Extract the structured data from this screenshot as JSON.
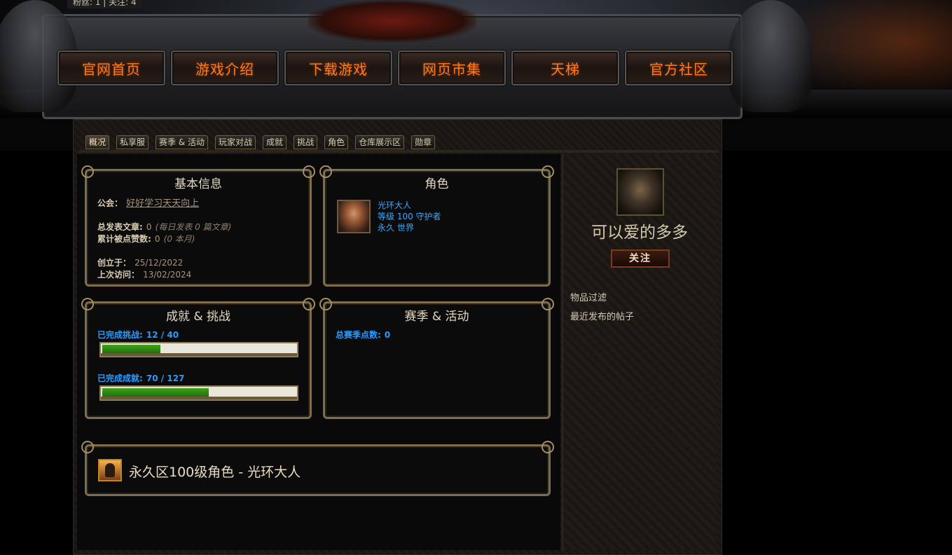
{
  "header": {
    "follow_stats": "粉丝: 1 | 关注: 4"
  },
  "nav": [
    "官网首页",
    "游戏介绍",
    "下载游戏",
    "网页市集",
    "天梯",
    "官方社区"
  ],
  "tabs": [
    "概况",
    "私享服",
    "赛季 & 活动",
    "玩家对战",
    "成就",
    "挑战",
    "角色",
    "仓库展示区",
    "勋章"
  ],
  "active_tab": "概况",
  "basic_info": {
    "title": "基本信息",
    "clan_label": "公会：",
    "clan_value": "好好学习天天向上",
    "posts_label": "总发表文章:",
    "posts_value": "0",
    "posts_note": "(每日发表 0 篇文章)",
    "likes_label": "累计被点赞数:",
    "likes_value": "0",
    "likes_note": "(0 本月)",
    "created_label": "创立于：",
    "created_value": "25/12/2022",
    "visited_label": "上次访问：",
    "visited_value": "13/02/2024"
  },
  "characters": {
    "title": "角色",
    "name": "光环大人",
    "level": "等级 100 守护者",
    "realm": "永久 世界",
    "portrait_icon": "character-portrait"
  },
  "achievements": {
    "title": "成就 & 挑战",
    "challenges_label": "已完成挑战:",
    "challenges_value": "12 / 40",
    "challenges_progress": 0.3,
    "achievements_label": "已完成成就:",
    "achievements_value": "70 / 127",
    "achievements_progress": 0.551
  },
  "seasons": {
    "title": "赛季 & 活动",
    "points_label": "总赛季点数:",
    "points_value": "0"
  },
  "featured": {
    "text": "永久区100级角色 - 光环大人",
    "icon": "character-silhouette-icon"
  },
  "profile": {
    "name": "可以爱的多多",
    "follow_button": "关注",
    "links": [
      "物品过滤",
      "最近发布的帖子"
    ],
    "avatar_icon": "hooded-avatar"
  },
  "colors": {
    "nav_text": "#ff7a1a",
    "link_blue": "#39a7ff",
    "progress_green": "#3fa21a"
  }
}
